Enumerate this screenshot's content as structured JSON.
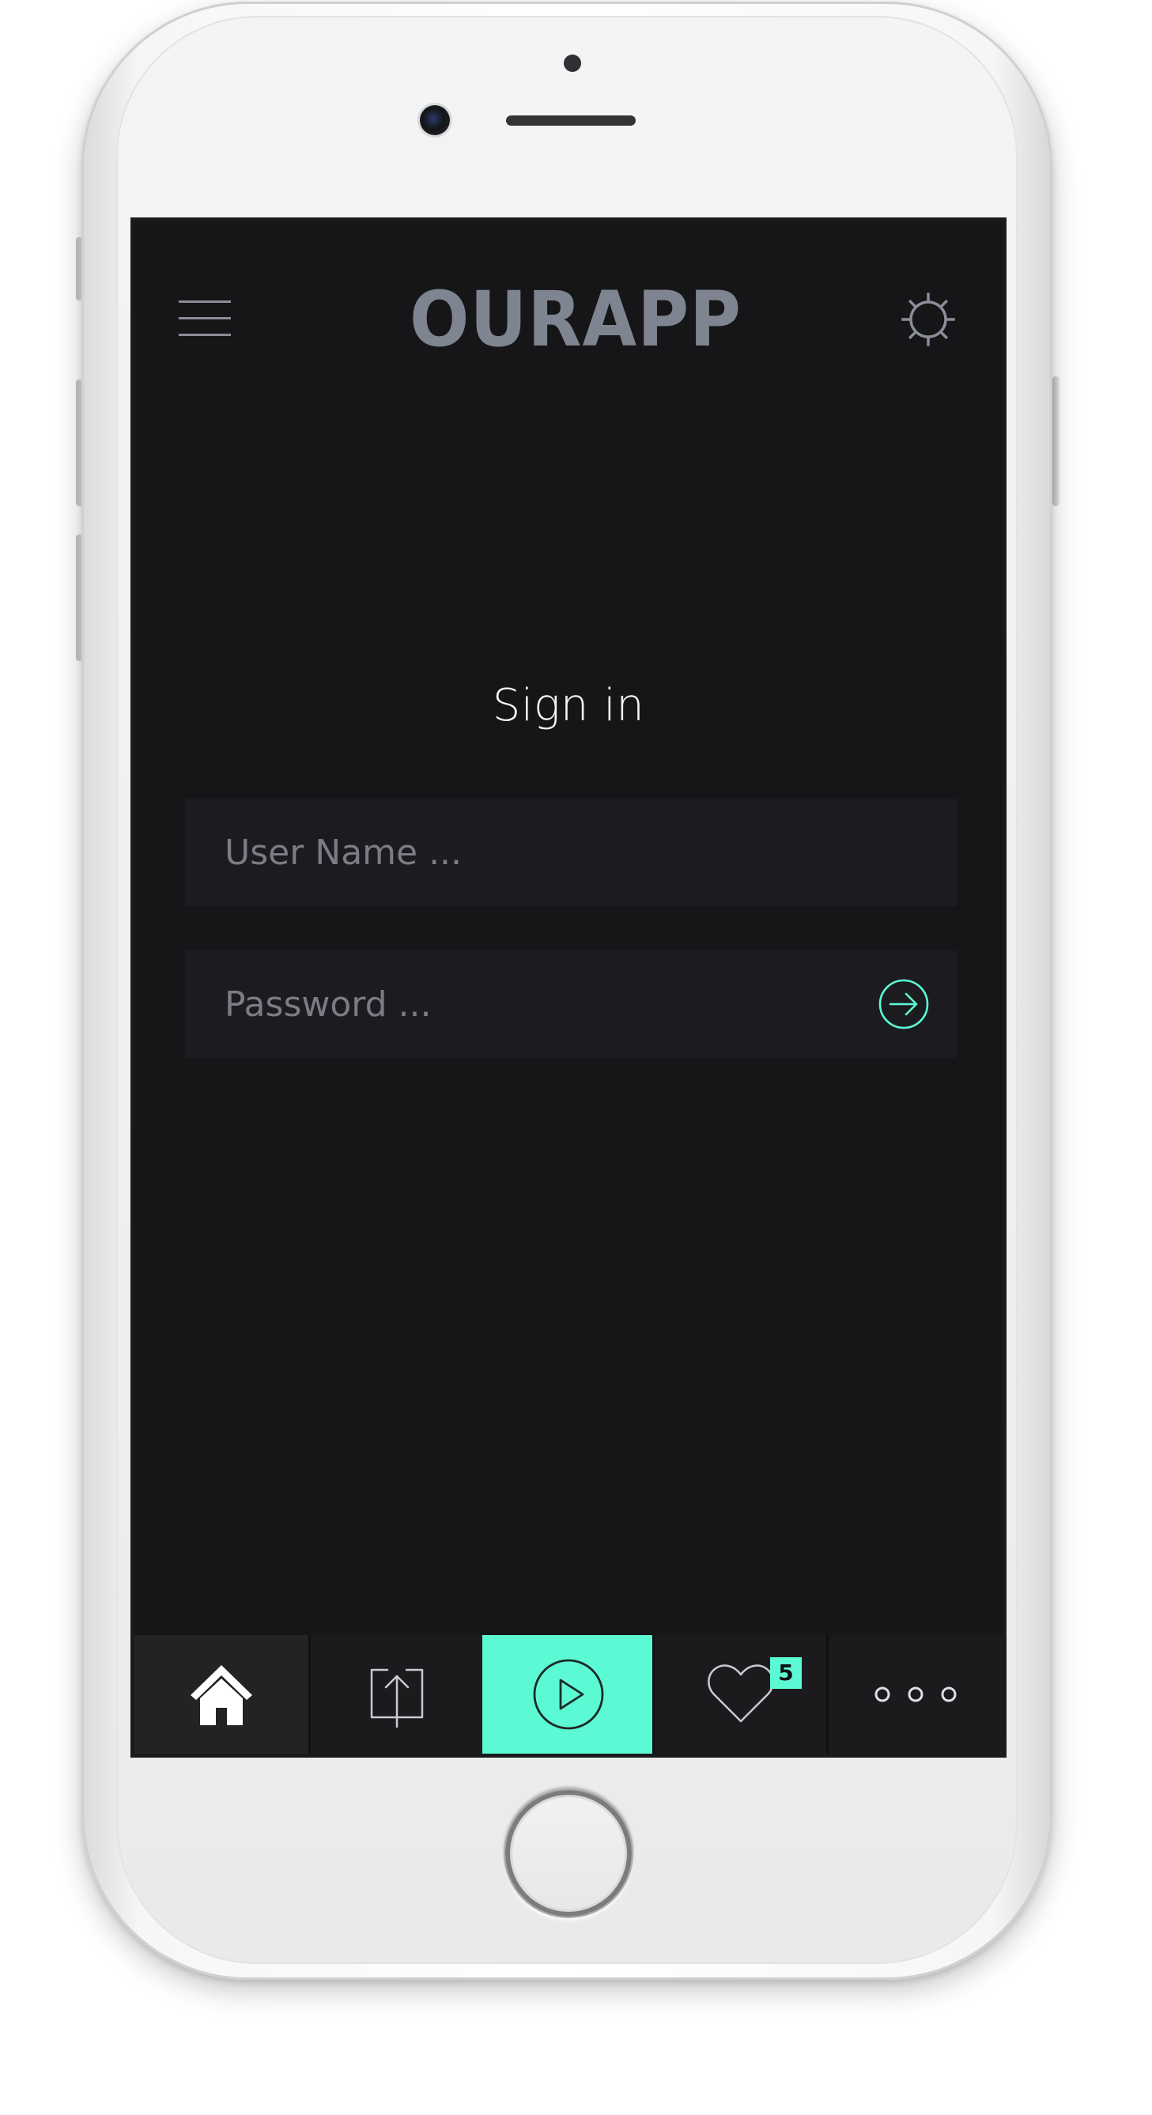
{
  "app": {
    "logo_text": "OURAPP",
    "accent_color": "#5cf9d5",
    "background_color": "#161618",
    "field_color": "#1c1c20"
  },
  "header": {
    "menu_icon": "hamburger-menu-icon",
    "settings_icon": "gear-icon"
  },
  "signin": {
    "title": "Sign in",
    "username_placeholder": "User Name ...",
    "username_value": "",
    "password_placeholder": "Password ...",
    "password_value": "",
    "submit_icon": "arrow-right-circle-icon"
  },
  "tabbar": {
    "tabs": [
      {
        "id": "home",
        "icon": "home-icon",
        "active": true
      },
      {
        "id": "upload",
        "icon": "upload-icon",
        "active": false
      },
      {
        "id": "play",
        "icon": "play-icon",
        "highlighted": true
      },
      {
        "id": "likes",
        "icon": "heart-icon",
        "badge": "5"
      },
      {
        "id": "more",
        "icon": "more-dots-icon"
      }
    ]
  }
}
